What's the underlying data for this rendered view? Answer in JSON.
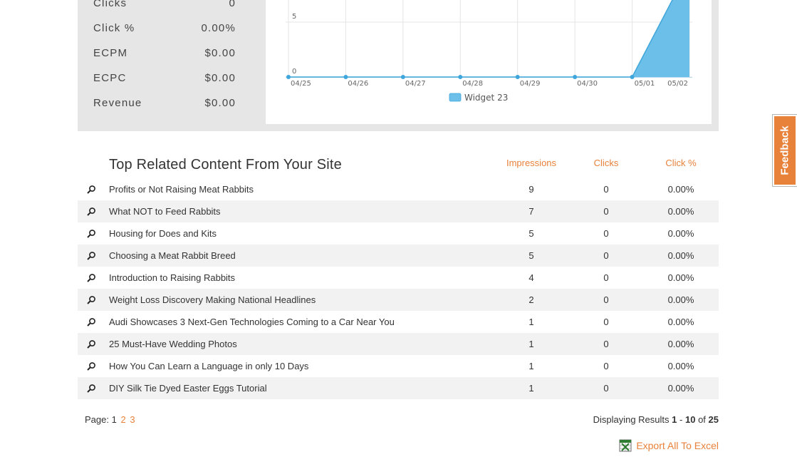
{
  "stats": [
    {
      "label": "Clicks",
      "value": "0"
    },
    {
      "label": "Click %",
      "value": "0.00%"
    },
    {
      "label": "ECPM",
      "value": "$0.00"
    },
    {
      "label": "ECPC",
      "value": "$0.00"
    },
    {
      "label": "Revenue",
      "value": "$0.00"
    }
  ],
  "chart_data": {
    "type": "area",
    "x": [
      "04/25",
      "04/26",
      "04/27",
      "04/28",
      "04/29",
      "04/30",
      "05/01",
      "05/02"
    ],
    "y_ticks": [
      "0",
      "5"
    ],
    "series": [
      {
        "name": "Widget 23",
        "values": [
          0,
          0,
          0,
          0,
          0,
          0,
          0,
          10
        ],
        "color": "#6cbfe9"
      }
    ]
  },
  "table": {
    "title": "Top Related Content From Your Site",
    "columns": [
      "Impressions",
      "Clicks",
      "Click %"
    ],
    "rows": [
      {
        "title": "Profits or Not Raising Meat Rabbits",
        "impressions": "9",
        "clicks": "0",
        "click_pct": "0.00%"
      },
      {
        "title": "What NOT to Feed Rabbits",
        "impressions": "7",
        "clicks": "0",
        "click_pct": "0.00%"
      },
      {
        "title": "Housing for Does and Kits",
        "impressions": "5",
        "clicks": "0",
        "click_pct": "0.00%"
      },
      {
        "title": "Choosing a Meat Rabbit Breed",
        "impressions": "5",
        "clicks": "0",
        "click_pct": "0.00%"
      },
      {
        "title": "Introduction to Raising Rabbits",
        "impressions": "4",
        "clicks": "0",
        "click_pct": "0.00%"
      },
      {
        "title": "Weight Loss Discovery Making National Headlines",
        "impressions": "2",
        "clicks": "0",
        "click_pct": "0.00%"
      },
      {
        "title": "Audi Showcases 3 Next-Gen Technologies Coming to a Car Near You",
        "impressions": "1",
        "clicks": "0",
        "click_pct": "0.00%"
      },
      {
        "title": "25 Must-Have Wedding Photos",
        "impressions": "1",
        "clicks": "0",
        "click_pct": "0.00%"
      },
      {
        "title": "How You Can Learn a Language in only 10 Days",
        "impressions": "1",
        "clicks": "0",
        "click_pct": "0.00%"
      },
      {
        "title": "DIY Silk Tie Dyed Easter Eggs Tutorial",
        "impressions": "1",
        "clicks": "0",
        "click_pct": "0.00%"
      }
    ]
  },
  "pager": {
    "label": "Page:",
    "current": "1",
    "pages": [
      "2",
      "3"
    ]
  },
  "results": {
    "prefix": "Displaying Results",
    "from": "1",
    "sep": "-",
    "to": "10",
    "of_label": "of",
    "total": "25"
  },
  "export": {
    "label": "Export All To Excel",
    "icon": "excel-icon"
  },
  "feedback": {
    "label": "Feedback"
  },
  "colors": {
    "accent": "#e8813a",
    "series": "#6cbfe9",
    "panel": "#e6e6e6"
  }
}
